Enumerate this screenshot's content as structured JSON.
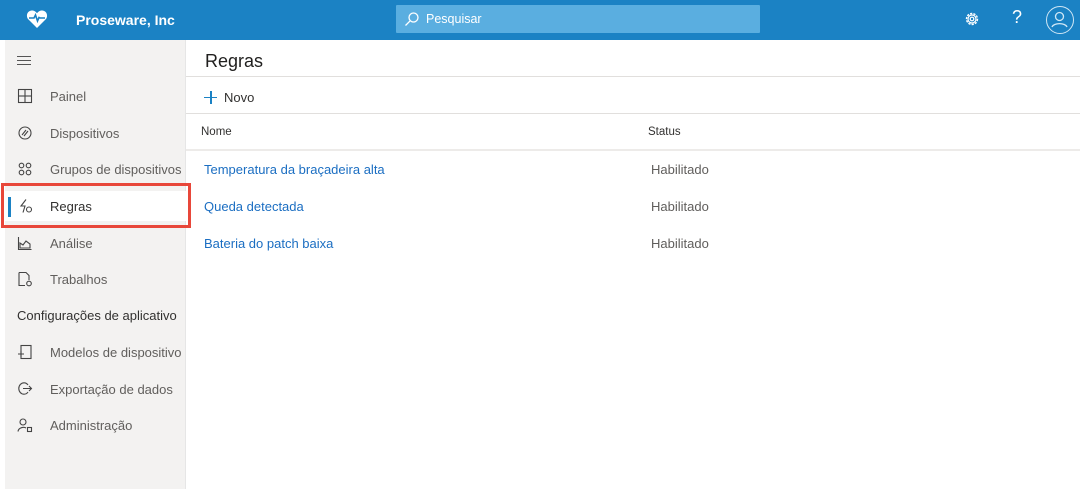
{
  "header": {
    "brand": "Proseware, Inc",
    "search_placeholder": "Pesquisar",
    "help_label": "?",
    "accent": "#1b82c4"
  },
  "sidebar": {
    "items": [
      {
        "label": "Painel",
        "icon": "dashboard-icon"
      },
      {
        "label": "Dispositivos",
        "icon": "devices-icon"
      },
      {
        "label": "Grupos de dispositivos",
        "icon": "device-groups-icon"
      },
      {
        "label": "Regras",
        "icon": "rules-icon",
        "active": true
      },
      {
        "label": "Análise",
        "icon": "analytics-icon"
      },
      {
        "label": "Trabalhos",
        "icon": "jobs-icon"
      }
    ],
    "section_title": "Configurações de aplicativo",
    "settings_items": [
      {
        "label": "Modelos de dispositivo",
        "icon": "device-templates-icon"
      },
      {
        "label": "Exportação de dados",
        "icon": "data-export-icon"
      },
      {
        "label": "Administração",
        "icon": "administration-icon"
      }
    ]
  },
  "main": {
    "title": "Regras",
    "new_label": "Novo",
    "columns": [
      "Nome",
      "Status"
    ],
    "rows": [
      {
        "name": "Temperatura da braçadeira alta",
        "status": "Habilitado"
      },
      {
        "name": "Queda detectada",
        "status": "Habilitado"
      },
      {
        "name": "Bateria do patch baixa",
        "status": "Habilitado"
      }
    ]
  }
}
